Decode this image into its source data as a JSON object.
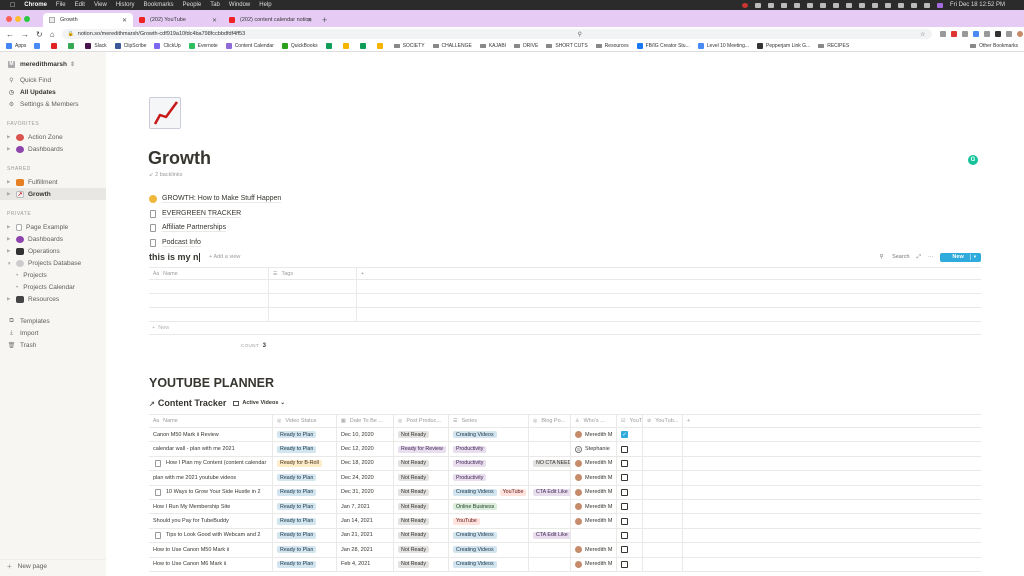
{
  "os_menubar": {
    "app": "Chrome",
    "menus": [
      "File",
      "Edit",
      "View",
      "History",
      "Bookmarks",
      "People",
      "Tab",
      "Window",
      "Help"
    ],
    "clock": "Fri Dec 18  12:52 PM"
  },
  "browser": {
    "tabs": [
      {
        "title": "Growth",
        "icon": "notion-page-icon",
        "active": true
      },
      {
        "title": "(202) YouTube",
        "icon": "youtube-icon",
        "active": false
      },
      {
        "title": "(202) content calendar notion",
        "icon": "youtube-icon",
        "active": false
      }
    ],
    "url": "notion.so/meredithmarsh/Growth-cdf919a10fdc4ba798fccbbdfdf4ff53",
    "bookmarks": [
      {
        "label": "Apps",
        "icon": "apps-grid-icon",
        "color": "#4285f4"
      },
      {
        "label": "",
        "icon": "google-docs-icon",
        "color": "#4a8af4"
      },
      {
        "label": "",
        "icon": "youtube-icon",
        "color": "#e22222"
      },
      {
        "label": "",
        "icon": "green-icon",
        "color": "#34a853"
      },
      {
        "label": "Slack",
        "icon": "slack-icon",
        "color": "#4a154b"
      },
      {
        "label": "ClipScribe",
        "icon": "clipscribe-icon",
        "color": "#3b5998"
      },
      {
        "label": "ClickUp",
        "icon": "clickup-icon",
        "color": "#7b68ee"
      },
      {
        "label": "Evernote",
        "icon": "evernote-icon",
        "color": "#2dbe60"
      },
      {
        "label": "Content Calendar",
        "icon": "calendar-icon",
        "color": "#8e6bd8"
      },
      {
        "label": "QuickBooks",
        "icon": "quickbooks-icon",
        "color": "#2ca01c"
      },
      {
        "label": "",
        "icon": "sheets-icon",
        "color": "#0f9d58"
      },
      {
        "label": "",
        "icon": "emoji-icon",
        "color": "#f4b400"
      },
      {
        "label": "",
        "icon": "sheets-icon",
        "color": "#0f9d58"
      },
      {
        "label": "",
        "icon": "emoji-icon",
        "color": "#f4b400"
      },
      {
        "label": "SOCIETY",
        "icon": "folder-icon"
      },
      {
        "label": "CHALLENGE",
        "icon": "folder-icon"
      },
      {
        "label": "KAJABI",
        "icon": "folder-icon"
      },
      {
        "label": "DRIVE",
        "icon": "folder-icon"
      },
      {
        "label": "SHORT CUTS",
        "icon": "folder-icon"
      },
      {
        "label": "Resources",
        "icon": "folder-icon"
      },
      {
        "label": "FB/IG Creator Stu...",
        "icon": "facebook-icon",
        "color": "#1877f2"
      },
      {
        "label": "Level 10 Meeting...",
        "icon": "docs-icon",
        "color": "#4a8af4"
      },
      {
        "label": "Pepperjam Link G...",
        "icon": "pepperjam-icon",
        "color": "#333333"
      },
      {
        "label": "RECIPES",
        "icon": "folder-icon"
      }
    ],
    "other_bookmarks": "Other Bookmarks"
  },
  "sidebar": {
    "workspace": "meredithmarsh",
    "workspace_initial": "M",
    "top_items": [
      {
        "label": "Quick Find",
        "icon": "search-icon"
      },
      {
        "label": "All Updates",
        "icon": "clock-icon"
      },
      {
        "label": "Settings & Members",
        "icon": "gear-icon"
      }
    ],
    "favorites_heading": "FAVORITES",
    "favorites": [
      {
        "label": "Action Zone",
        "icon": "action-zone-icon",
        "color": "#d9534f"
      },
      {
        "label": "Dashboards",
        "icon": "dashboards-icon",
        "color": "#8e44ad"
      }
    ],
    "shared_heading": "SHARED",
    "shared": [
      {
        "label": "Fulfillment",
        "icon": "truck-icon",
        "color": "#e67e22"
      },
      {
        "label": "Growth",
        "icon": "chart-increasing-icon",
        "color": "#d63031",
        "selected": true
      }
    ],
    "private_heading": "PRIVATE",
    "private": [
      {
        "label": "Page Example",
        "icon": "page-icon",
        "color": "#cccccc"
      },
      {
        "label": "Dashboards",
        "icon": "dashboards-icon",
        "color": "#8e44ad"
      },
      {
        "label": "Operations",
        "icon": "computer-icon",
        "color": "#333333"
      },
      {
        "label": "Projects Database",
        "icon": "globe-icon",
        "color": "#aaaaaa",
        "expanded": true
      },
      {
        "label": "Projects",
        "sub": true
      },
      {
        "label": "Projects Calendar",
        "sub": true
      },
      {
        "label": "Resources",
        "icon": "cabinet-icon",
        "color": "#444444"
      }
    ],
    "bottom_items": [
      {
        "label": "Templates",
        "icon": "templates-icon"
      },
      {
        "label": "Import",
        "icon": "import-icon"
      },
      {
        "label": "Trash",
        "icon": "trash-icon"
      }
    ],
    "new_page": "New page"
  },
  "page": {
    "title": "Growth",
    "backlinks": "2 backlinks",
    "links": [
      {
        "label": "GROWTH: How to Make Stuff Happen",
        "icon": "smiley-icon"
      },
      {
        "label": "EVERGREEN TRACKER",
        "icon": "page-icon"
      },
      {
        "label": "Affiliate Partnerships",
        "icon": "page-icon"
      },
      {
        "label": "Podcast Info",
        "icon": "page-icon"
      }
    ],
    "inline_db": {
      "title": "this is my n",
      "add_view": "Add a view",
      "search": "Search",
      "new": "New",
      "columns": [
        "Name",
        "Tags"
      ],
      "rows": [
        [
          "",
          ""
        ],
        [
          "",
          ""
        ],
        [
          "",
          ""
        ]
      ],
      "new_row": "New",
      "count_label": "COUNT",
      "count_value": "3"
    },
    "section_heading": "YOUTUBE PLANNER",
    "tracker": {
      "title": "Content Tracker",
      "view": "Active Videos",
      "columns": [
        "Name",
        "Video Status",
        "Date To Be ...",
        "Post Produc...",
        "Series",
        "Blog Po...",
        "Who's ...",
        "YouTub...",
        "YouTub..."
      ],
      "rows": [
        {
          "name": "Canon M50 Mark ii Review",
          "doc": false,
          "status": "Ready to Plan",
          "date": "Dec 10, 2020",
          "post": "Not Ready",
          "series": [
            "Creating Videos"
          ],
          "blog": "",
          "who": "Meredith M",
          "who_type": "photo",
          "done": true
        },
        {
          "name": "calendar wall - plan with me 2021",
          "doc": false,
          "status": "Ready to Plan",
          "date": "Dec 12, 2020",
          "post": "Ready for Review",
          "series": [
            "Productivity"
          ],
          "blog": "",
          "who": "Stephanie",
          "who_type": "initial",
          "done": false
        },
        {
          "name": "How I Plan my Content (content calendar",
          "doc": true,
          "status": "Ready for B-Roll",
          "date": "Dec 18, 2020",
          "post": "Not Ready",
          "series": [
            "Productivity"
          ],
          "blog": "NO CTA NEEDED",
          "who": "Meredith M",
          "who_type": "photo",
          "done": false
        },
        {
          "name": "plan with me 2021 youtube videos",
          "doc": false,
          "status": "Ready to Plan",
          "date": "Dec 24, 2020",
          "post": "Not Ready",
          "series": [
            "Productivity"
          ],
          "blog": "",
          "who": "Meredith M",
          "who_type": "photo",
          "done": false
        },
        {
          "name": "10 Ways to Grow Your Side Hustle in 2",
          "doc": true,
          "status": "Ready to Plan",
          "date": "Dec 31, 2020",
          "post": "Not Ready",
          "series": [
            "Creating Videos",
            "YouTube"
          ],
          "blog": "CTA Edit Like",
          "who": "Meredith M",
          "who_type": "photo",
          "done": false
        },
        {
          "name": "How I Run My Membership Site",
          "doc": false,
          "status": "Ready to Plan",
          "date": "Jan 7, 2021",
          "post": "Not Ready",
          "series": [
            "Online Business"
          ],
          "blog": "",
          "who": "Meredith M",
          "who_type": "photo",
          "done": false
        },
        {
          "name": "Should you Pay for TubeBuddy",
          "doc": false,
          "status": "Ready to Plan",
          "date": "Jan 14, 2021",
          "post": "Not Ready",
          "series": [
            "YouTube"
          ],
          "blog": "",
          "who": "Meredith M",
          "who_type": "photo",
          "done": false
        },
        {
          "name": "Tips to Look Good with Webcam and 2",
          "doc": true,
          "status": "Ready to Plan",
          "date": "Jan 21, 2021",
          "post": "Not Ready",
          "series": [
            "Creating Videos"
          ],
          "blog": "CTA Edit Like",
          "who": "",
          "who_type": "none",
          "done": false
        },
        {
          "name": "How to Use Canon M50 Mark ii",
          "doc": false,
          "status": "Ready to Plan",
          "date": "Jan 28, 2021",
          "post": "Not Ready",
          "series": [
            "Creating Videos"
          ],
          "blog": "",
          "who": "Meredith M",
          "who_type": "photo",
          "done": false
        },
        {
          "name": "How to Use Canon M6 Mark ii",
          "doc": false,
          "status": "Ready to Plan",
          "date": "Feb 4, 2021",
          "post": "Not Ready",
          "series": [
            "Creating Videos"
          ],
          "blog": "",
          "who": "Meredith M",
          "who_type": "photo",
          "done": false
        }
      ]
    }
  },
  "tag_colors": {
    "Ready to Plan": {
      "bg": "#d3e5ef",
      "fg": "#183347"
    },
    "Ready for B-Roll": {
      "bg": "#fdecc8",
      "fg": "#402c1b"
    },
    "Not Ready": {
      "bg": "#e3e2e0",
      "fg": "#32302c"
    },
    "Ready for Review": {
      "bg": "#e8deee",
      "fg": "#412454"
    },
    "Creating Videos": {
      "bg": "#d3e5ef",
      "fg": "#183347"
    },
    "Productivity": {
      "bg": "#e8deee",
      "fg": "#412454"
    },
    "YouTube": {
      "bg": "#ffe2dd",
      "fg": "#5d1715"
    },
    "Online Business": {
      "bg": "#dbeddb",
      "fg": "#1c3829"
    },
    "NO CTA NEEDED": {
      "bg": "#e3e2e0",
      "fg": "#32302c"
    },
    "CTA Edit Like": {
      "bg": "#e8deee",
      "fg": "#412454"
    }
  }
}
